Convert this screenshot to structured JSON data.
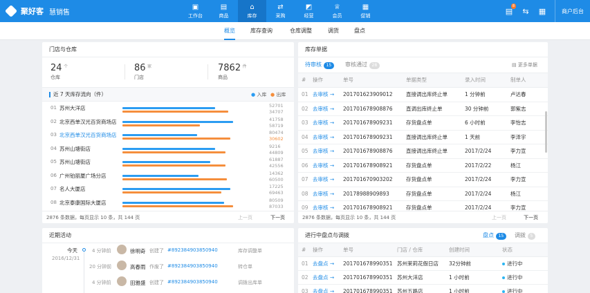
{
  "app": {
    "name": "聚好客",
    "module": "慧销售",
    "admin_label": "商户后台",
    "notif_count": "8"
  },
  "nav": [
    {
      "label": "工作台",
      "icon": "▣"
    },
    {
      "label": "商品",
      "icon": "▤"
    },
    {
      "label": "库存",
      "icon": "⌂"
    },
    {
      "label": "采购",
      "icon": "⇄"
    },
    {
      "label": "经营",
      "icon": "◩"
    },
    {
      "label": "会员",
      "icon": "♕"
    },
    {
      "label": "促销",
      "icon": "▦"
    }
  ],
  "subnav": [
    "概览",
    "库存查询",
    "仓库调整",
    "调货",
    "盘点"
  ],
  "store": {
    "title": "门店与仓库",
    "stats": [
      {
        "value": "24",
        "unit": "个",
        "label": "仓库"
      },
      {
        "value": "86",
        "unit": "家",
        "label": "门店"
      },
      {
        "value": "7862",
        "unit": "件",
        "label": "商品"
      }
    ],
    "flow_title": "近 7 天库存流向（件）",
    "legend_in": "入库",
    "legend_out": "出库",
    "rows": [
      {
        "rank": "01",
        "name": "苏州大洋店",
        "in": "52701",
        "out": "34707",
        "in_frac": 0.72,
        "out_frac": 0.82,
        "highlight": false
      },
      {
        "rank": "02",
        "name": "北京西单汉光百货商场店",
        "in": "41758",
        "out": "58719",
        "in_frac": 0.86,
        "out_frac": 0.6,
        "highlight": false
      },
      {
        "rank": "03",
        "name": "北京西单汉光百货商场店",
        "in": "80474",
        "out": "30602",
        "in_frac": 0.58,
        "out_frac": 0.84,
        "highlight": true
      },
      {
        "rank": "04",
        "name": "苏州山塘街店",
        "in": "9216",
        "out": "44809",
        "in_frac": 0.72,
        "out_frac": 0.8,
        "highlight": false
      },
      {
        "rank": "05",
        "name": "苏州山塘街店",
        "in": "61887",
        "out": "42556",
        "in_frac": 0.68,
        "out_frac": 0.8,
        "highlight": false
      },
      {
        "rank": "06",
        "name": "广州铂丽厦广场分店",
        "in": "14362",
        "out": "60500",
        "in_frac": 0.59,
        "out_frac": 0.81,
        "highlight": false
      },
      {
        "rank": "07",
        "name": "名人大厦店",
        "in": "17225",
        "out": "69463",
        "in_frac": 0.84,
        "out_frac": 0.77,
        "highlight": false
      },
      {
        "rank": "08",
        "name": "北京泰康国际大厦店",
        "in": "80509",
        "out": "87033",
        "in_frac": 0.79,
        "out_frac": 0.86,
        "highlight": false
      }
    ],
    "footer": "2876 条数据，每页显示 10 条，共 144 页",
    "prev": "上一页",
    "next": "下一页"
  },
  "orders": {
    "title": "库存单据",
    "tab_pending": "待审核",
    "pending_count": "15",
    "tab_passed": "审核通过",
    "passed_count": "28",
    "more": "更多单据",
    "columns": [
      "#",
      "操作",
      "单号",
      "单据类型",
      "录入时间",
      "制单人"
    ],
    "rows": [
      {
        "idx": "01",
        "op": "去审核 →",
        "no": "201701623909012",
        "type": "直接调出库终止单",
        "time": "1 分钟前",
        "maker": "卢达春"
      },
      {
        "idx": "02",
        "op": "去审核 →",
        "no": "201701678908876",
        "type": "直调出库终止单",
        "time": "30 分钟前",
        "maker": "郭紫志"
      },
      {
        "idx": "03",
        "op": "去审核 →",
        "no": "201701678909231",
        "type": "存货盘点单",
        "time": "6 小时前",
        "maker": "李怡志"
      },
      {
        "idx": "04",
        "op": "去审核 →",
        "no": "201701678909231",
        "type": "直接调出库终止单",
        "time": "1 天前",
        "maker": "李泽宇"
      },
      {
        "idx": "05",
        "op": "去审核 →",
        "no": "201701678908876",
        "type": "直接调出库终止单",
        "time": "2017/2/24",
        "maker": "李力宣"
      },
      {
        "idx": "06",
        "op": "去审核 →",
        "no": "201701678908921",
        "type": "存货盘点单",
        "time": "2017/2/22",
        "maker": "杨江"
      },
      {
        "idx": "07",
        "op": "去审核 →",
        "no": "201701670903202",
        "type": "存货盘点单",
        "time": "2017/2/24",
        "maker": "李力宣"
      },
      {
        "idx": "08",
        "op": "去审核 →",
        "no": "20178988909893",
        "type": "存货盘点单",
        "time": "2017/2/24",
        "maker": "杨江"
      },
      {
        "idx": "09",
        "op": "去审核 →",
        "no": "201701678908921",
        "type": "存货盘点单",
        "time": "2017/2/24",
        "maker": "李力宣"
      }
    ],
    "footer": "2876 条数据，每页显示 10 条，共 144 页",
    "prev": "上一页",
    "next": "下一页"
  },
  "activity": {
    "title": "近期活动",
    "today": "今天",
    "date": "2016/12/31",
    "items": [
      {
        "time": "4 分钟前",
        "user": "徐明奇",
        "pre": "创建了",
        "code": "#892384903850940",
        "post": "库存调整单"
      },
      {
        "time": "20 分钟前",
        "user": "高春雨",
        "pre": "作废了",
        "code": "#892384903850940",
        "post": "转仓单"
      },
      {
        "time": "4 分钟前",
        "user": "田雅盛",
        "pre": "创建了",
        "code": "#892384903850940",
        "post": "调拨出库单"
      }
    ]
  },
  "inventory": {
    "title": "进行中盘点与调拨",
    "tab_count": "盘点",
    "count_count": "15",
    "tab_transfer": "调拨",
    "transfer_count": "5",
    "columns": [
      "#",
      "操作",
      "单号",
      "门店 / 仓库",
      "创建时间",
      "状态"
    ],
    "rows": [
      {
        "idx": "01",
        "op": "去盘点 →",
        "no": "201701678990351",
        "store": "苏州茉莉花假日店",
        "time": "32分钟前",
        "status": "进行中"
      },
      {
        "idx": "02",
        "op": "去盘点 →",
        "no": "201701678990351",
        "store": "苏州大洋店",
        "time": "1 小时前",
        "status": "进行中"
      },
      {
        "idx": "03",
        "op": "去盘点 →",
        "no": "201701678990351",
        "store": "苏州五路店",
        "time": "1 小时前",
        "status": "进行中"
      }
    ]
  }
}
